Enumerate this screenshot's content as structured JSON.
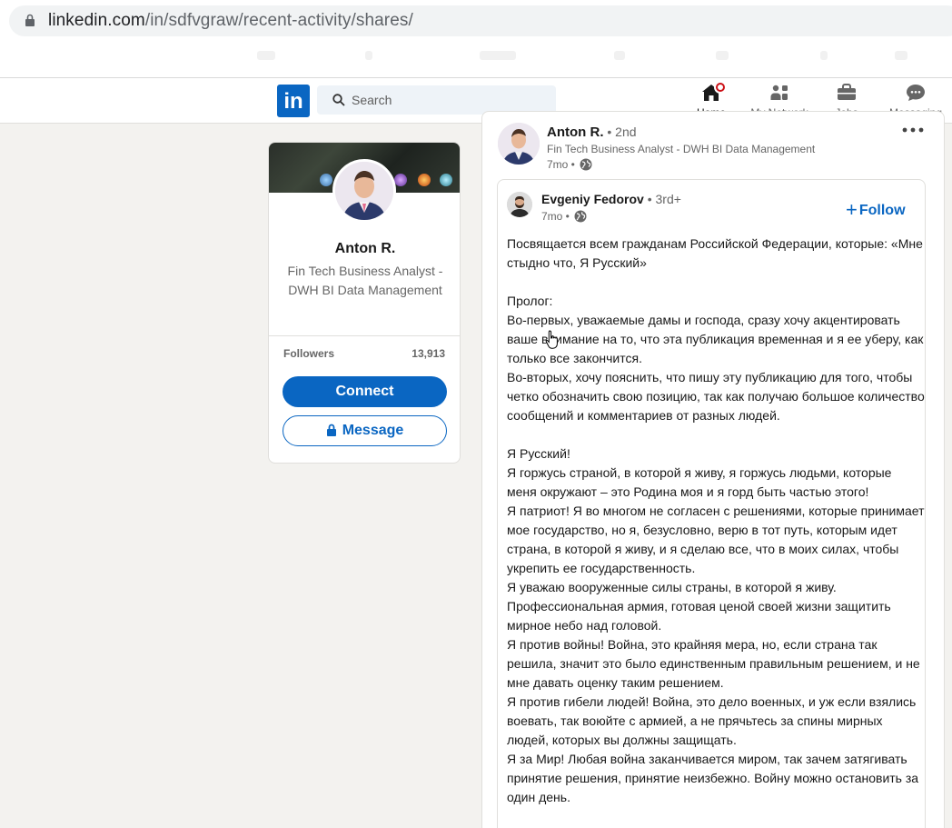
{
  "browser": {
    "url_host": "linkedin.com",
    "url_path": "/in/sdfvgraw/recent-activity/shares/"
  },
  "header": {
    "logo": "in",
    "search_placeholder": "Search",
    "nav": [
      {
        "label": "Home",
        "icon": "home-icon"
      },
      {
        "label": "My Network",
        "icon": "network-icon"
      },
      {
        "label": "Jobs",
        "icon": "briefcase-icon"
      },
      {
        "label": "Messaging",
        "icon": "messaging-icon"
      }
    ]
  },
  "profile": {
    "name": "Anton R.",
    "headline": "Fin Tech Business Analyst - DWH BI Data Management",
    "followers_label": "Followers",
    "followers_count": "13,913",
    "connect_label": "Connect",
    "message_label": "Message"
  },
  "post": {
    "author": "Anton R.",
    "degree": "• 2nd",
    "headline": "Fin Tech Business Analyst - DWH BI Data Management",
    "time": "7mo •",
    "shared": {
      "author": "Evgeniy Fedorov",
      "degree": "• 3rd+",
      "time": "7mo •",
      "follow_label": "Follow",
      "text": "Посвящается всем гражданам Российской Федерации, которые: «Мне стыдно что, Я Русский»\n\nПролог:\nВо-первых, уважаемые дамы и господа, сразу хочу акцентировать ваше внимание на то, что эта публикация временная и я ее уберу, как только все закончится.\nВо-вторых, хочу пояснить, что пишу эту публикацию для того, чтобы четко обозначить свою позицию, так как получаю большое количество сообщений и комментариев от разных людей.\n\nЯ Русский!\nЯ горжусь страной, в которой я живу, я горжусь людьми, которые меня окружают – это Родина моя и я горд быть частью этого!\nЯ патриот! Я во многом не согласен с решениями, которые принимает мое государство, но я, безусловно, верю в тот путь, которым идет страна, в которой я живу, и я сделаю все, что в моих силах, чтобы укрепить ее государственность.\nЯ уважаю вооруженные силы страны, в которой я живу. Профессиональная армия, готовая ценой своей жизни защитить мирное небо над головой.\nЯ против войны! Война, это крайняя мера, но, если страна так решила, значит это было единственным правильным решением, и не мне давать оценку таким решением.\nЯ против гибели людей! Война, это дело военных, и уж если взялись воевать, так воюйте с армией, а не прячьтесь за спины мирных людей, которых вы должны защищать.\nЯ за Мир! Любая война заканчивается миром, так зачем затягивать принятие решения, принятие неизбежно. Войну можно остановить за один день."
    }
  },
  "colors": {
    "brand": "#0a66c2",
    "notification": "#cc1016",
    "background": "#f3f2ef"
  }
}
